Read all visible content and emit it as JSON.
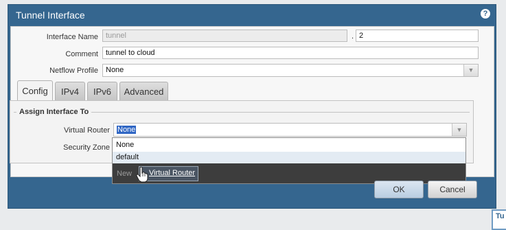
{
  "dialog": {
    "title": "Tunnel Interface",
    "help_icon": "question-circle-icon",
    "help_glyph": "?"
  },
  "form": {
    "interface_name_label": "Interface Name",
    "interface_name_value": "tunnel",
    "separator": ".",
    "interface_number": "2",
    "comment_label": "Comment",
    "comment_value": "tunnel to cloud",
    "netflow_label": "Netflow Profile",
    "netflow_value": "None",
    "dropdown_arrow": "▼"
  },
  "tabs": [
    {
      "label": "Config",
      "active": true
    },
    {
      "label": "IPv4",
      "active": false
    },
    {
      "label": "IPv6",
      "active": false
    },
    {
      "label": "Advanced",
      "active": false
    }
  ],
  "assign": {
    "legend": "Assign Interface To",
    "virtual_router_label": "Virtual Router",
    "virtual_router_value": "None",
    "security_zone_label": "Security Zone"
  },
  "dropdown": {
    "options": [
      "None",
      "default"
    ],
    "hovered_option": "default",
    "new_label": "New",
    "new_link": "Virtual Router"
  },
  "buttons": {
    "ok": "OK",
    "cancel": "Cancel"
  },
  "corner": {
    "text": "Tu"
  }
}
